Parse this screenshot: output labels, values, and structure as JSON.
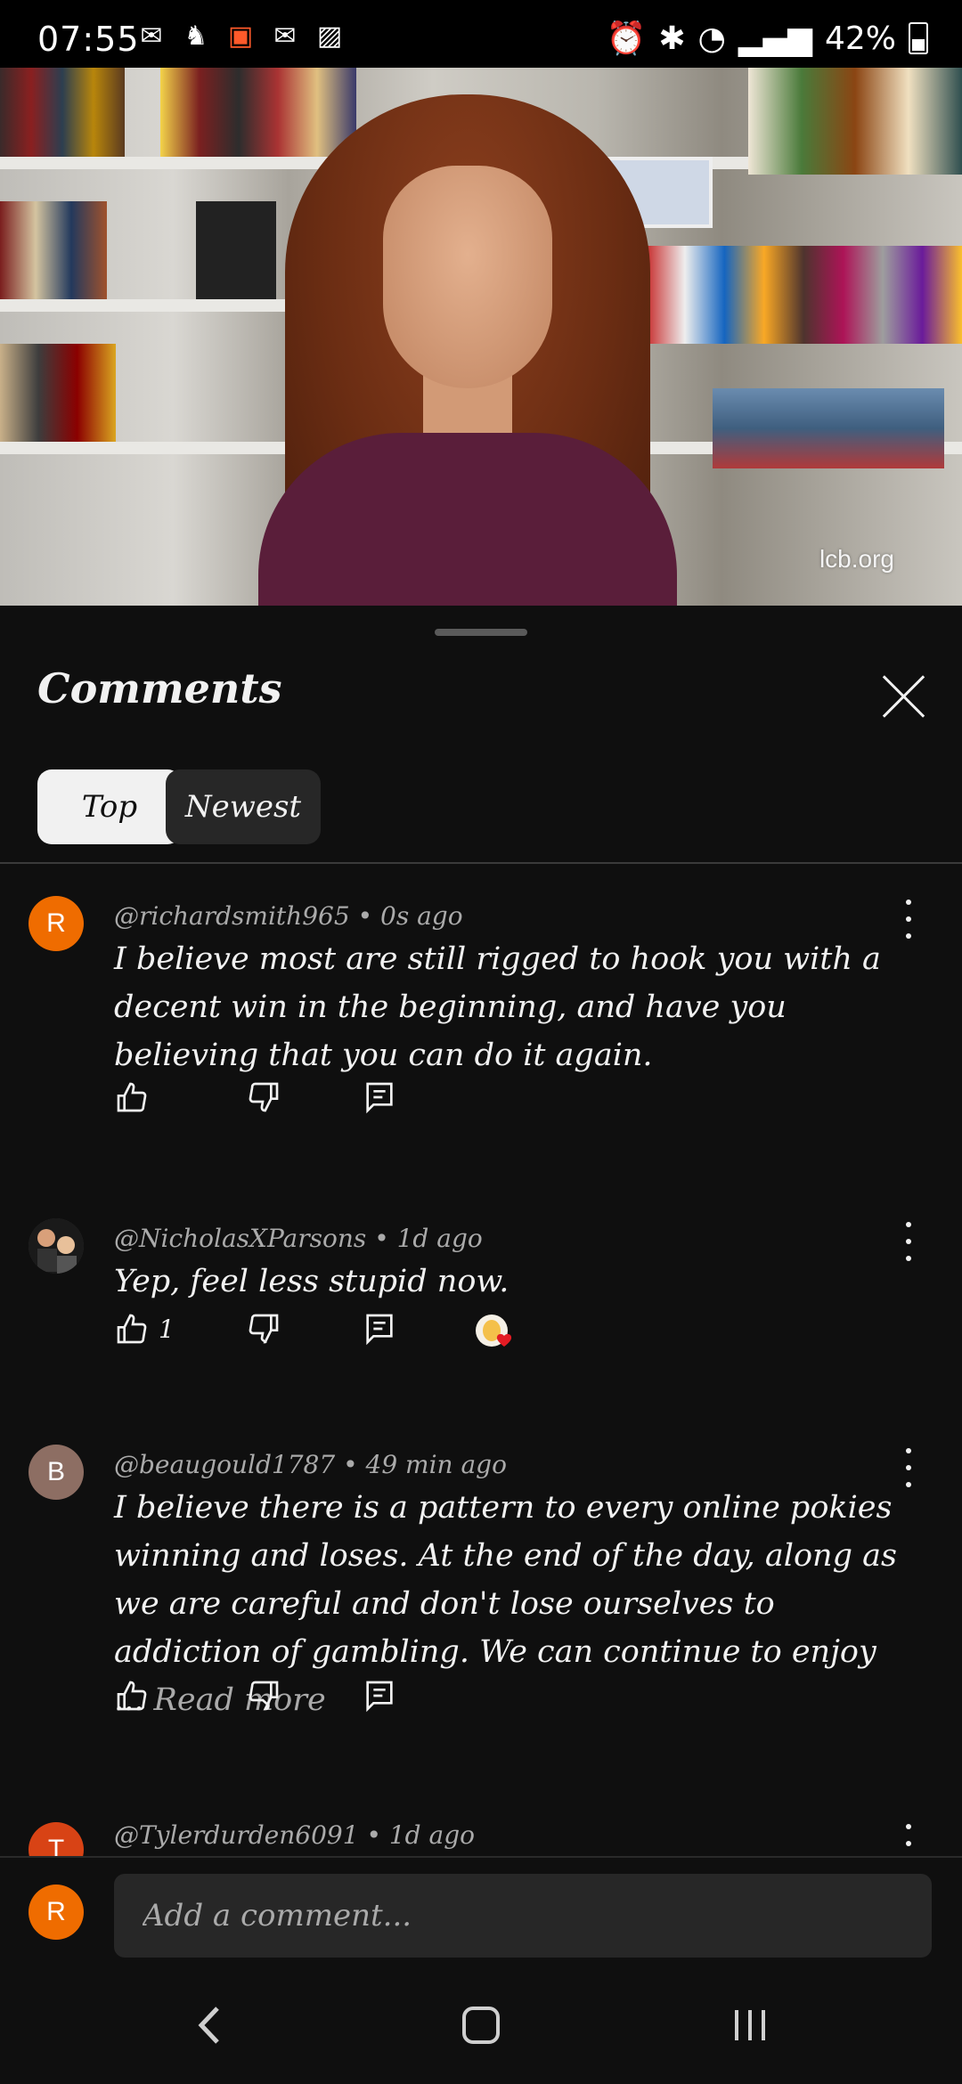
{
  "status_bar": {
    "time": "07:55",
    "battery": "42%",
    "left_icons": [
      "gmail-icon",
      "app-icon",
      "flipboard-icon",
      "gmail-icon",
      "gallery-icon"
    ],
    "right_icons": [
      "alarm-icon",
      "bluetooth-icon",
      "wifi-icon",
      "signal-icon",
      "battery-icon"
    ]
  },
  "video": {
    "watermark": "lcb.org"
  },
  "comments_sheet": {
    "title": "Comments",
    "filters": [
      {
        "label": "Top",
        "selected": true
      },
      {
        "label": "Newest",
        "selected": false
      }
    ],
    "comments": [
      {
        "avatar_letter": "R",
        "avatar_color": "#ef6c00",
        "author": "@richardsmith965",
        "time": "0s ago",
        "text": "I believe most are still rigged to hook you with a decent win in the beginning, and have you believing that you can do it again.",
        "likes": ""
      },
      {
        "avatar_letter": "",
        "avatar_color": "#3a3a3a",
        "author": "@NicholasXParsons",
        "time": "1d ago",
        "text": "Yep, feel less stupid now.",
        "likes": "1",
        "creator_heart": true
      },
      {
        "avatar_letter": "B",
        "avatar_color": "#8d6e63",
        "author": "@beaugould1787",
        "time": "49 min ago",
        "text": "I believe there is a pattern to every online pokies winning and loses. At the end of the day, along as we are careful and don't lose ourselves to addiction of gambling. We can continue to enjoy ...",
        "read_more": "Read more",
        "likes": ""
      },
      {
        "avatar_letter": "T",
        "avatar_color": "#d84315",
        "author": "@Tylerdurden6091",
        "time": "1d ago"
      }
    ],
    "add_comment": {
      "avatar_letter": "R",
      "placeholder": "Add a comment..."
    }
  }
}
